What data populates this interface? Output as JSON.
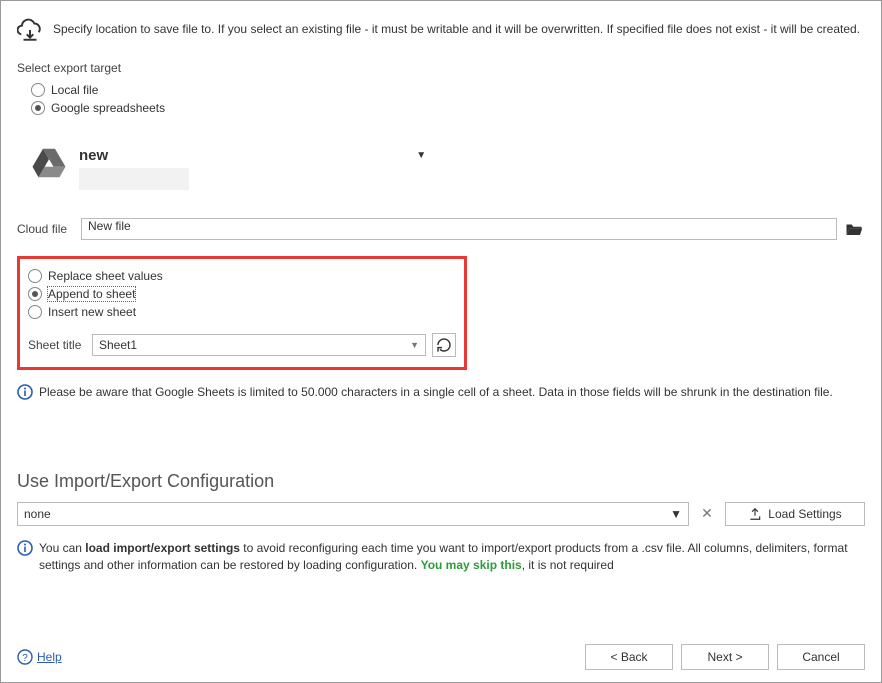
{
  "header": {
    "description": "Specify location to save file to. If you select an existing file - it must be writable and it will be overwritten. If specified file does not exist - it will be created."
  },
  "target": {
    "label": "Select export target",
    "options": {
      "local_file": "Local file",
      "google_spreadsheets": "Google spreadsheets"
    },
    "selected": "google_spreadsheets"
  },
  "drive": {
    "name": "new"
  },
  "cloud_file": {
    "label": "Cloud file",
    "value": "New file"
  },
  "sheet_mode": {
    "options": {
      "replace": "Replace sheet values",
      "append": "Append to sheet",
      "insert": "Insert new sheet"
    },
    "selected": "append"
  },
  "sheet_title": {
    "label": "Sheet title",
    "value": "Sheet1"
  },
  "warning": "Please be aware that Google Sheets is limited to 50.000 characters in a single cell of a sheet. Data in those fields will be shrunk in the destination file.",
  "config": {
    "heading": "Use Import/Export Configuration",
    "selected": "none",
    "load_button": "Load Settings",
    "tip_pre": "You can ",
    "tip_bold": "load import/export settings",
    "tip_mid": " to avoid reconfiguring each time you want to import/export products from a .csv file. All columns, delimiters, format settings and other information can be restored by loading configuration. ",
    "tip_green": "You may skip this",
    "tip_end": ", it is not required"
  },
  "footer": {
    "help": "Help",
    "back": "< Back",
    "next": "Next >",
    "cancel": "Cancel"
  }
}
